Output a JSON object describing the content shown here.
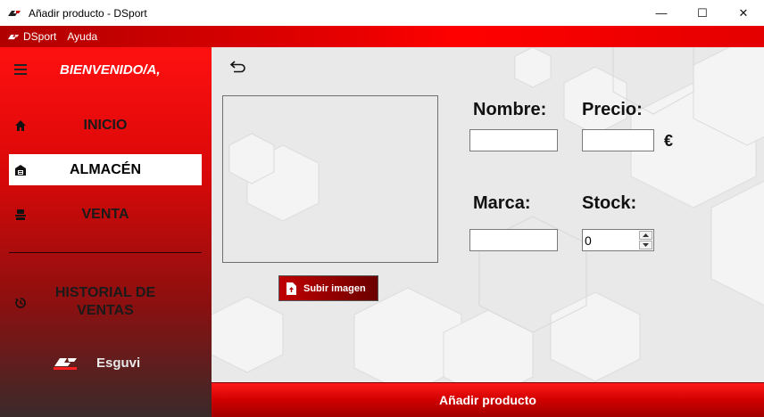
{
  "window": {
    "title": "Añadir producto - DSport",
    "minimize_glyph": "—",
    "maximize_glyph": "☐",
    "close_glyph": "✕"
  },
  "menu": {
    "items": [
      {
        "label": "DSport",
        "icon": "dsport-logo-icon"
      },
      {
        "label": "Ayuda"
      }
    ]
  },
  "sidebar": {
    "welcome": "BIENVENIDO/A,",
    "nav": [
      {
        "label": "INICIO",
        "icon": "home-icon",
        "active": false
      },
      {
        "label": "ALMACÉN",
        "icon": "warehouse-icon",
        "active": true
      },
      {
        "label": "VENTA",
        "icon": "sale-icon",
        "active": false
      }
    ],
    "history_label": "HISTORIAL DE VENTAS",
    "user": {
      "name": "Esguvi",
      "logo": "DSPORT"
    }
  },
  "form": {
    "upload_label": "Subir imagen",
    "name_label": "Nombre:",
    "name_value": "",
    "price_label": "Precio:",
    "price_value": "",
    "currency": "€",
    "brand_label": "Marca:",
    "brand_value": "",
    "stock_label": "Stock:",
    "stock_value": "0"
  },
  "actions": {
    "add_label": "Añadir producto"
  },
  "colors": {
    "accent": "#e60000",
    "dark": "#1a1a1a"
  }
}
